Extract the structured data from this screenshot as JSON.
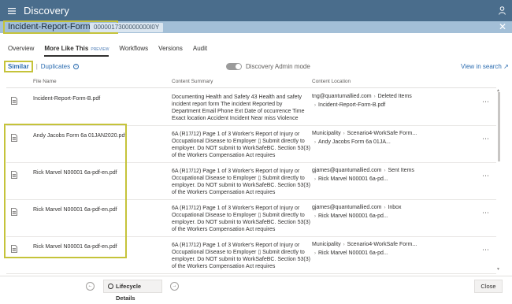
{
  "app": {
    "title": "Discovery"
  },
  "document": {
    "title": "Incident-Report-Form-B.pdf",
    "id": "0000017300000000I0Y"
  },
  "tabs": [
    {
      "label": "Overview"
    },
    {
      "label": "More Like This",
      "badge": "PREVIEW",
      "active": true
    },
    {
      "label": "Workflows"
    },
    {
      "label": "Versions"
    },
    {
      "label": "Audit"
    }
  ],
  "subtabs": {
    "similar": "Similar",
    "separator": "|",
    "duplicates": "Duplicates"
  },
  "admin_mode_label": "Discovery Admin mode",
  "view_in_search": "View in search",
  "columns": {
    "file_name": "File Name",
    "content_summary": "Content Summary",
    "content_location": "Content Location"
  },
  "rows": [
    {
      "file_name": "Incident-Report-Form-B.pdf",
      "summary": "Documenting Health and Safety 43 Health and safety incident report form The incident Reported by Department Email Phone Ext Date of occurrence Time Exact location Accident Incident Near miss Violence",
      "loc1_a": "tng@quantumallied.com",
      "loc1_b": "Deleted Items",
      "loc2": "Incident-Report-Form-B.pdf"
    },
    {
      "file_name": "Andy Jacobs Form 6a 01JAN2020.pdf",
      "summary": "6A (R17/12) Page 1 of 3 Worker's Report of Injury or Occupational Disease to Employer ▯ Submit directly to employer. Do NOT submit to WorkSafeBC. Section 53(3) of the Workers Compensation Act requires",
      "loc1_a": "Municipality",
      "loc1_b": "Scenario4-WorkSafe Form...",
      "loc2": "Andy Jacobs Form 6a 01JA..."
    },
    {
      "file_name": "Rick Marvel N00001 6a-pdf-en.pdf",
      "summary": "6A (R17/12) Page 1 of 3 Worker's Report of Injury or Occupational Disease to Employer ▯ Submit directly to employer. Do NOT submit to WorkSafeBC. Section 53(3) of the Workers Compensation Act requires",
      "loc1_a": "gjames@quantumallied.com",
      "loc1_b": "Sent Items",
      "loc2": "Rick Marvel N00001 6a-pd..."
    },
    {
      "file_name": "Rick Marvel N00001 6a-pdf-en.pdf",
      "summary": "6A (R17/12) Page 1 of 3 Worker's Report of Injury or Occupational Disease to Employer ▯ Submit directly to employer. Do NOT submit to WorkSafeBC. Section 53(3) of the Workers Compensation Act requires",
      "loc1_a": "gjames@quantumallied.com",
      "loc1_b": "Inbox",
      "loc2": "Rick Marvel N00001 6a-pd..."
    },
    {
      "file_name": "Rick Marvel N00001 6a-pdf-en.pdf",
      "summary": "6A (R17/12) Page 1 of 3 Worker's Report of Injury or Occupational Disease to Employer ▯ Submit directly to employer. Do NOT submit to WorkSafeBC. Section 53(3) of the Workers Compensation Act requires",
      "loc1_a": "Municipality",
      "loc1_b": "Scenario4-WorkSafe Form...",
      "loc2": "Rick Marvel N00001 6a-pd..."
    }
  ],
  "row_more": "⋯",
  "footer": {
    "lifecycle_label": "Lifecycle Details",
    "close_label": "Close"
  },
  "colors": {
    "topbar": "#4a6d8c",
    "docbar": "#a3bfd7",
    "highlight": "#c5c33a",
    "link": "#2b6cb0"
  }
}
